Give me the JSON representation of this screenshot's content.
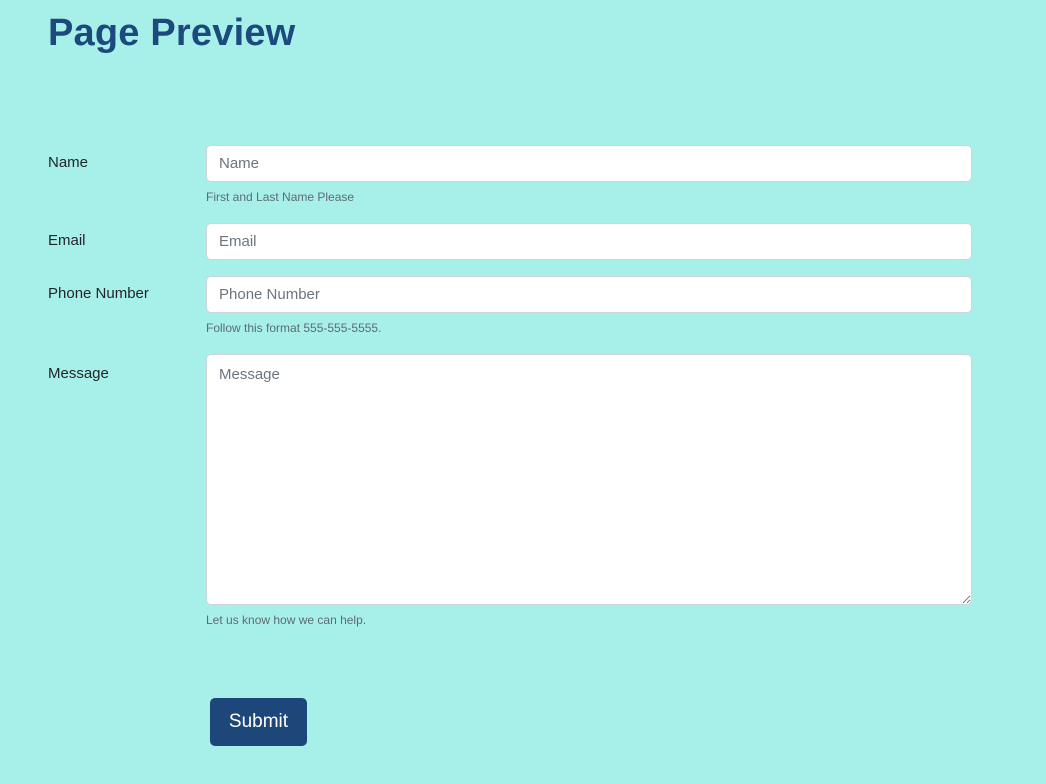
{
  "page": {
    "title": "Page Preview"
  },
  "form": {
    "name": {
      "label": "Name",
      "placeholder": "Name",
      "value": "",
      "help": "First and Last Name Please"
    },
    "email": {
      "label": "Email",
      "placeholder": "Email",
      "value": ""
    },
    "phone": {
      "label": "Phone Number",
      "placeholder": "Phone Number",
      "value": "",
      "help": "Follow this format 555-555-5555."
    },
    "message": {
      "label": "Message",
      "placeholder": "Message",
      "value": "",
      "help": "Let us know how we can help."
    },
    "submit_label": "Submit"
  },
  "colors": {
    "background": "#a6f0e9",
    "title": "#1c4a7c",
    "button": "#1d4679"
  }
}
